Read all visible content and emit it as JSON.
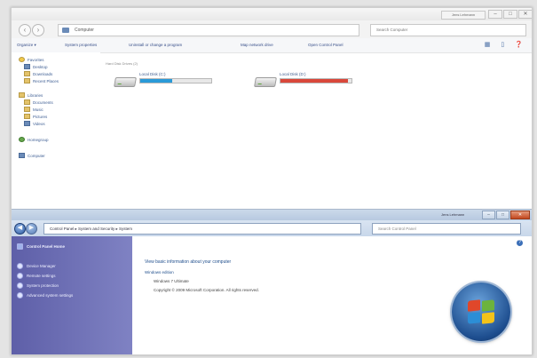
{
  "computer_window": {
    "user_button": "Jens Lehmann",
    "window_controls": [
      "–",
      "□",
      "✕"
    ],
    "address": "Computer",
    "search_placeholder": "Search Computer",
    "toolbar": [
      "Organize ▾",
      "System properties",
      "Uninstall or change a program",
      "Map network drive",
      "Open Control Panel"
    ],
    "nav": {
      "favorites": "Favorites",
      "favorites_items": [
        "Desktop",
        "Downloads",
        "Recent Places"
      ],
      "libraries": "Libraries",
      "libraries_items": [
        "Documents",
        "Music",
        "Pictures",
        "Videos"
      ],
      "homegroup": "Homegroup",
      "computer": "Computer"
    },
    "group_header": "Hard Disk Drives (2)",
    "drives": [
      {
        "label": "Local Disk (C:)",
        "free_text": "",
        "used_fraction": 0.45,
        "color": "#2a9ad8"
      },
      {
        "label": "Local Disk (D:)",
        "free_text": "",
        "used_fraction": 0.95,
        "color": "#d9473a"
      }
    ]
  },
  "system_window": {
    "user_button": "Jens Lehmann",
    "address": "Control Panel ▸ System and Security ▸ System",
    "search_placeholder": "Search Control Panel",
    "sidebar": {
      "home": "Control Panel Home",
      "links": [
        "Device Manager",
        "Remote settings",
        "System protection",
        "Advanced system settings"
      ]
    },
    "main": {
      "heading": "View basic information about your computer",
      "edition_header": "Windows edition",
      "edition": "Windows 7 Ultimate",
      "copyright": "Copyright © 2009 Microsoft Corporation.  All rights reserved."
    },
    "colors": {
      "sidebar": "#6c6eb6",
      "accent": "#2d5aa0",
      "close": "#c2471f"
    }
  }
}
